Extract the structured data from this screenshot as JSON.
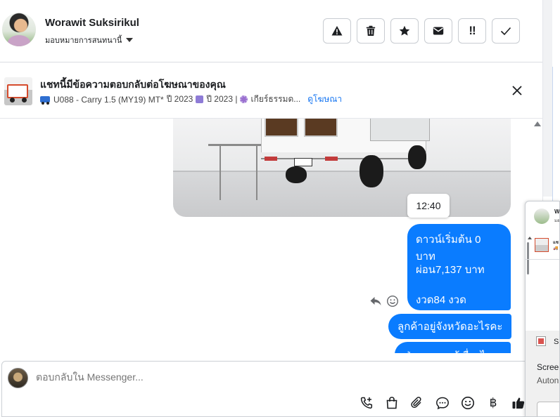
{
  "header": {
    "contact_name": "Worawit Suksirikul",
    "assign_label": "มอบหมายการสนทนานี้",
    "actions": [
      {
        "name": "report-button",
        "icon": "warning-icon"
      },
      {
        "name": "delete-button",
        "icon": "trash-icon"
      },
      {
        "name": "star-button",
        "icon": "star-icon"
      },
      {
        "name": "mark-unread-button",
        "icon": "envelope-icon"
      },
      {
        "name": "priority-button",
        "icon": "double-exclamation-icon",
        "text": "!!"
      },
      {
        "name": "done-button",
        "icon": "check-icon"
      }
    ]
  },
  "ad_banner": {
    "title": "แชทนี้มีข้อความตอบกลับต่อโฆษณาของคุณ",
    "detail_model": "U088 - Carry 1.5 (MY19) MT*",
    "detail_year1": "ปี 2023",
    "detail_year2": "ปี 2023 |",
    "detail_gear": "เกียร์ธรรมด...",
    "view_ad_link": "ดูโฆษณา"
  },
  "chat": {
    "timestamp": "12:40",
    "message_lines": [
      "ดาวน์เริ่มต้น 0 บาท",
      "ผ่อน7,137 บาท",
      "งวด84 งวด"
    ],
    "message_2": "ลูกค้าอยู่จังหวัดอะไรคะ",
    "message_3": "ปุ่มลงอยากรู้เรื่องไหน"
  },
  "composer": {
    "placeholder": "ตอบกลับใน Messenger...",
    "icons": [
      "call-add-icon",
      "shopping-bag-icon",
      "paperclip-icon",
      "saved-replies-icon",
      "emoji-icon",
      "baht-icon",
      "thumbs-up-icon"
    ],
    "baht_symbol": "฿"
  },
  "side_popup": {
    "name_snippet": "Wo",
    "sub_snippet": "มอ",
    "ad_snippet_1": "แช",
    "ad_snippet_2": "🚚",
    "toast_app": "Sn",
    "toast_title": "Scree",
    "toast_sub": "Auton"
  },
  "colors": {
    "accent": "#0a7cff",
    "link": "#1877f2"
  }
}
